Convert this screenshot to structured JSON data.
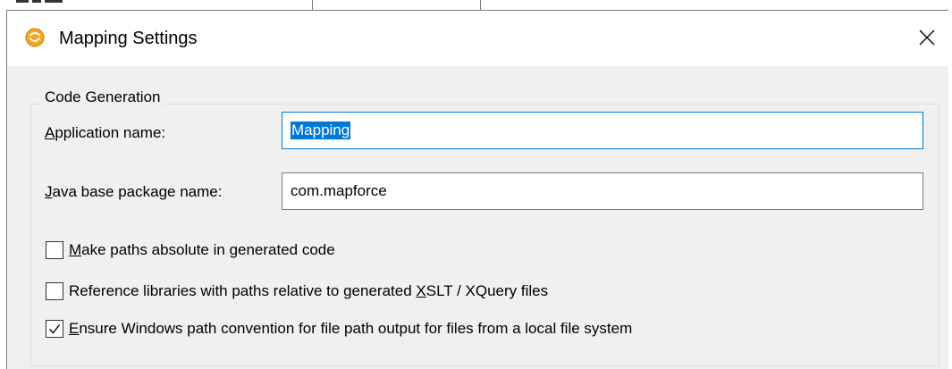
{
  "window": {
    "title": "Mapping Settings"
  },
  "group": {
    "legend": "Code Generation"
  },
  "fields": {
    "app_name": {
      "label_mnemonic": "A",
      "label_rest": "pplication name:",
      "value": "Mapping"
    },
    "java_package": {
      "label_mnemonic": "J",
      "label_rest": "ava base package name:",
      "value": "com.mapforce"
    }
  },
  "checkboxes": [
    {
      "mnemonic": "M",
      "rest": "ake paths absolute in generated code",
      "checked": false
    },
    {
      "before": "Reference libraries with paths relative to generated ",
      "mnemonic": "X",
      "rest": "SLT / XQuery files",
      "checked": false
    },
    {
      "mnemonic": "E",
      "rest": "nsure Windows path convention for file path output for files from a local file system",
      "checked": true
    }
  ],
  "colors": {
    "dialog_bg": "#f0f0f0",
    "focus_border": "#0078d7",
    "selection": "#0078d7",
    "app_icon": "#f5a623"
  },
  "icons": {
    "app": "mapforce-app-icon",
    "close": "close-icon",
    "check": "checkmark-icon"
  }
}
